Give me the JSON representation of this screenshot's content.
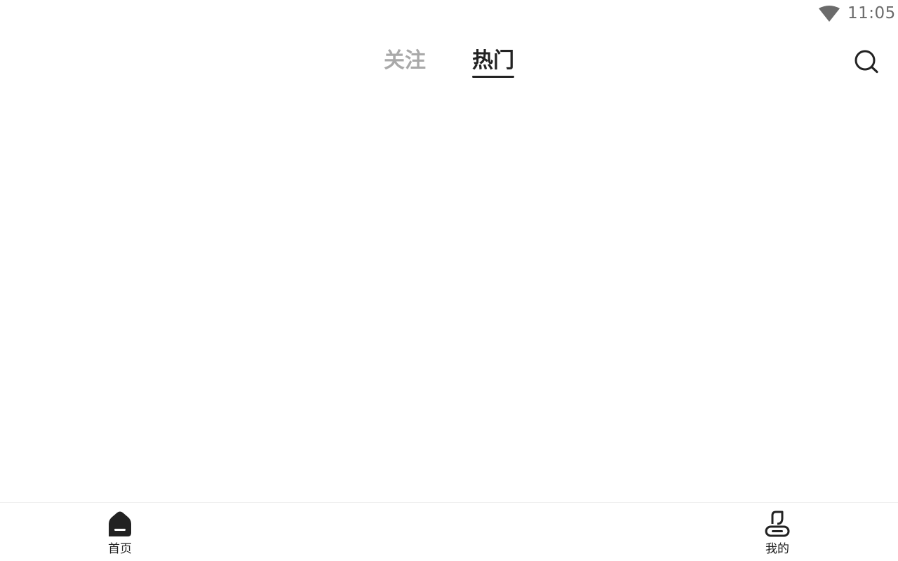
{
  "status_bar": {
    "time": "11:05",
    "wifi_icon": "wifi-icon"
  },
  "top_tabs": {
    "items": [
      {
        "label": "关注",
        "active": false
      },
      {
        "label": "热门",
        "active": true
      }
    ],
    "search_icon": "search-icon"
  },
  "bottom_nav": {
    "items": [
      {
        "label": "首页",
        "icon": "home-icon",
        "active": true
      },
      {
        "label": "我的",
        "icon": "profile-icon",
        "active": false
      }
    ]
  },
  "colors": {
    "active_text": "#222222",
    "inactive_text": "#a9a9a9",
    "status_text": "#6b6b6b",
    "background": "#ffffff"
  }
}
